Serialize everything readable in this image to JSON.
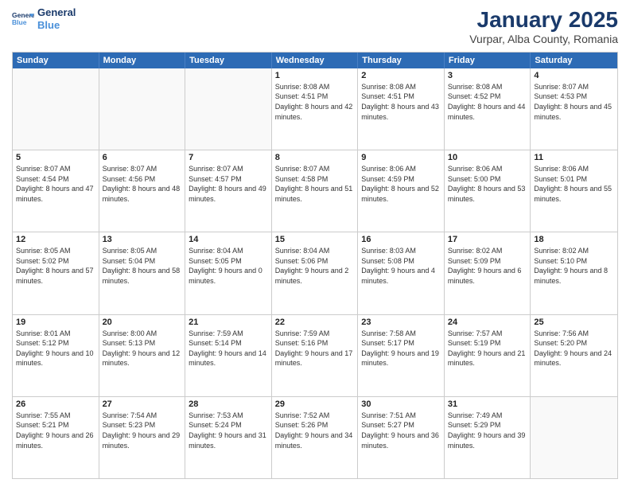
{
  "logo": {
    "line1": "General",
    "line2": "Blue"
  },
  "title": "January 2025",
  "subtitle": "Vurpar, Alba County, Romania",
  "header_days": [
    "Sunday",
    "Monday",
    "Tuesday",
    "Wednesday",
    "Thursday",
    "Friday",
    "Saturday"
  ],
  "weeks": [
    [
      {
        "day": "",
        "info": "",
        "empty": true
      },
      {
        "day": "",
        "info": "",
        "empty": true
      },
      {
        "day": "",
        "info": "",
        "empty": true
      },
      {
        "day": "1",
        "info": "Sunrise: 8:08 AM\nSunset: 4:51 PM\nDaylight: 8 hours and 42 minutes.",
        "empty": false
      },
      {
        "day": "2",
        "info": "Sunrise: 8:08 AM\nSunset: 4:51 PM\nDaylight: 8 hours and 43 minutes.",
        "empty": false
      },
      {
        "day": "3",
        "info": "Sunrise: 8:08 AM\nSunset: 4:52 PM\nDaylight: 8 hours and 44 minutes.",
        "empty": false
      },
      {
        "day": "4",
        "info": "Sunrise: 8:07 AM\nSunset: 4:53 PM\nDaylight: 8 hours and 45 minutes.",
        "empty": false
      }
    ],
    [
      {
        "day": "5",
        "info": "Sunrise: 8:07 AM\nSunset: 4:54 PM\nDaylight: 8 hours and 47 minutes.",
        "empty": false
      },
      {
        "day": "6",
        "info": "Sunrise: 8:07 AM\nSunset: 4:56 PM\nDaylight: 8 hours and 48 minutes.",
        "empty": false
      },
      {
        "day": "7",
        "info": "Sunrise: 8:07 AM\nSunset: 4:57 PM\nDaylight: 8 hours and 49 minutes.",
        "empty": false
      },
      {
        "day": "8",
        "info": "Sunrise: 8:07 AM\nSunset: 4:58 PM\nDaylight: 8 hours and 51 minutes.",
        "empty": false
      },
      {
        "day": "9",
        "info": "Sunrise: 8:06 AM\nSunset: 4:59 PM\nDaylight: 8 hours and 52 minutes.",
        "empty": false
      },
      {
        "day": "10",
        "info": "Sunrise: 8:06 AM\nSunset: 5:00 PM\nDaylight: 8 hours and 53 minutes.",
        "empty": false
      },
      {
        "day": "11",
        "info": "Sunrise: 8:06 AM\nSunset: 5:01 PM\nDaylight: 8 hours and 55 minutes.",
        "empty": false
      }
    ],
    [
      {
        "day": "12",
        "info": "Sunrise: 8:05 AM\nSunset: 5:02 PM\nDaylight: 8 hours and 57 minutes.",
        "empty": false
      },
      {
        "day": "13",
        "info": "Sunrise: 8:05 AM\nSunset: 5:04 PM\nDaylight: 8 hours and 58 minutes.",
        "empty": false
      },
      {
        "day": "14",
        "info": "Sunrise: 8:04 AM\nSunset: 5:05 PM\nDaylight: 9 hours and 0 minutes.",
        "empty": false
      },
      {
        "day": "15",
        "info": "Sunrise: 8:04 AM\nSunset: 5:06 PM\nDaylight: 9 hours and 2 minutes.",
        "empty": false
      },
      {
        "day": "16",
        "info": "Sunrise: 8:03 AM\nSunset: 5:08 PM\nDaylight: 9 hours and 4 minutes.",
        "empty": false
      },
      {
        "day": "17",
        "info": "Sunrise: 8:02 AM\nSunset: 5:09 PM\nDaylight: 9 hours and 6 minutes.",
        "empty": false
      },
      {
        "day": "18",
        "info": "Sunrise: 8:02 AM\nSunset: 5:10 PM\nDaylight: 9 hours and 8 minutes.",
        "empty": false
      }
    ],
    [
      {
        "day": "19",
        "info": "Sunrise: 8:01 AM\nSunset: 5:12 PM\nDaylight: 9 hours and 10 minutes.",
        "empty": false
      },
      {
        "day": "20",
        "info": "Sunrise: 8:00 AM\nSunset: 5:13 PM\nDaylight: 9 hours and 12 minutes.",
        "empty": false
      },
      {
        "day": "21",
        "info": "Sunrise: 7:59 AM\nSunset: 5:14 PM\nDaylight: 9 hours and 14 minutes.",
        "empty": false
      },
      {
        "day": "22",
        "info": "Sunrise: 7:59 AM\nSunset: 5:16 PM\nDaylight: 9 hours and 17 minutes.",
        "empty": false
      },
      {
        "day": "23",
        "info": "Sunrise: 7:58 AM\nSunset: 5:17 PM\nDaylight: 9 hours and 19 minutes.",
        "empty": false
      },
      {
        "day": "24",
        "info": "Sunrise: 7:57 AM\nSunset: 5:19 PM\nDaylight: 9 hours and 21 minutes.",
        "empty": false
      },
      {
        "day": "25",
        "info": "Sunrise: 7:56 AM\nSunset: 5:20 PM\nDaylight: 9 hours and 24 minutes.",
        "empty": false
      }
    ],
    [
      {
        "day": "26",
        "info": "Sunrise: 7:55 AM\nSunset: 5:21 PM\nDaylight: 9 hours and 26 minutes.",
        "empty": false
      },
      {
        "day": "27",
        "info": "Sunrise: 7:54 AM\nSunset: 5:23 PM\nDaylight: 9 hours and 29 minutes.",
        "empty": false
      },
      {
        "day": "28",
        "info": "Sunrise: 7:53 AM\nSunset: 5:24 PM\nDaylight: 9 hours and 31 minutes.",
        "empty": false
      },
      {
        "day": "29",
        "info": "Sunrise: 7:52 AM\nSunset: 5:26 PM\nDaylight: 9 hours and 34 minutes.",
        "empty": false
      },
      {
        "day": "30",
        "info": "Sunrise: 7:51 AM\nSunset: 5:27 PM\nDaylight: 9 hours and 36 minutes.",
        "empty": false
      },
      {
        "day": "31",
        "info": "Sunrise: 7:49 AM\nSunset: 5:29 PM\nDaylight: 9 hours and 39 minutes.",
        "empty": false
      },
      {
        "day": "",
        "info": "",
        "empty": true
      }
    ]
  ]
}
